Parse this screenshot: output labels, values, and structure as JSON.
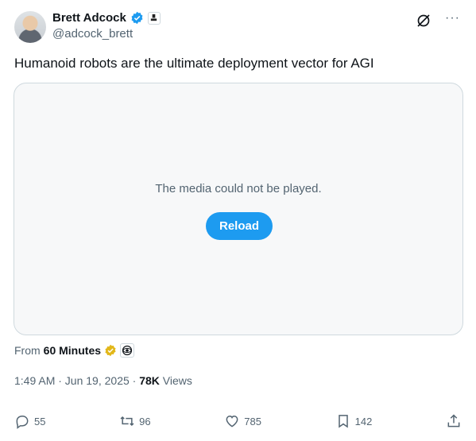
{
  "author": {
    "name": "Brett Adcock",
    "handle": "@adcock_brett"
  },
  "tweet": {
    "text": "Humanoid robots are the ultimate deployment vector for AGI"
  },
  "media": {
    "message": "The media could not be played.",
    "reload_label": "Reload"
  },
  "source": {
    "from_label": "From",
    "name": "60 Minutes"
  },
  "meta": {
    "time": "1:49 AM · Jun 19, 2025 · ",
    "views_count": "78K",
    "views_label": " Views"
  },
  "actions": {
    "replies": "55",
    "reposts": "96",
    "likes": "785",
    "bookmarks": "142"
  },
  "colors": {
    "accent": "#1d9bf0",
    "gold": "#e2b719",
    "muted": "#536471"
  }
}
